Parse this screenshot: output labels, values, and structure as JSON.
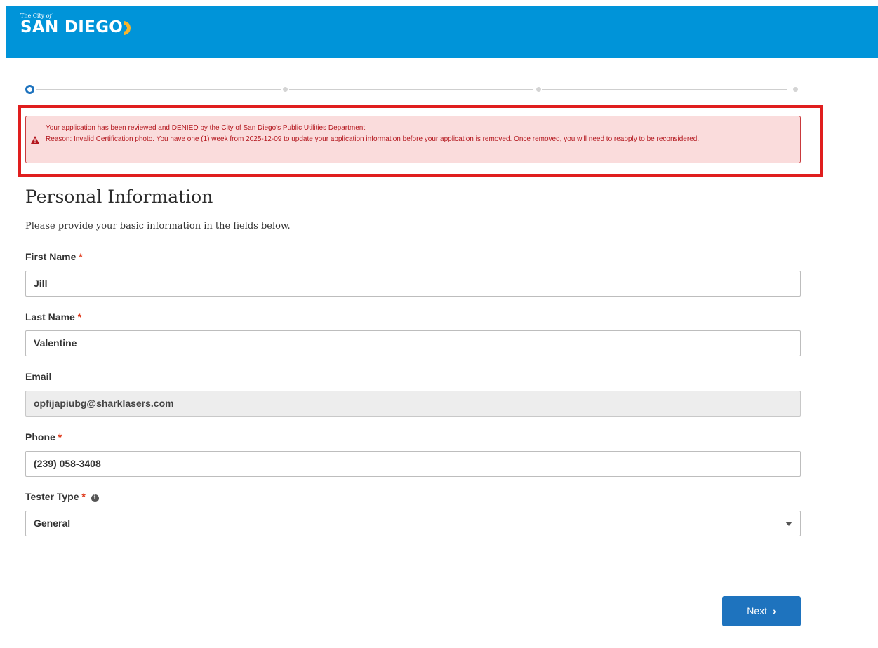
{
  "header": {
    "logo_small": "The City of",
    "logo_big": "SAN DIEGO",
    "brand_color": "#0094d9"
  },
  "stepper": {
    "total_steps": 4,
    "current_step": 1
  },
  "alert": {
    "line1": "Your application has been reviewed and DENIED by the City of San Diego's Public Utilities Department.",
    "line2": "Reason: Invalid Certification photo. You have one (1) week from 2025-12-09 to update your application information before your application is removed. Once removed, you will need to reapply to be reconsidered.",
    "icon": "warning-icon",
    "color": "#b3161d"
  },
  "form": {
    "title": "Personal Information",
    "subtitle": "Please provide your basic information in the fields below.",
    "required_marker": "*",
    "first_name": {
      "label": "First Name",
      "value": "Jill"
    },
    "last_name": {
      "label": "Last Name",
      "value": "Valentine"
    },
    "email": {
      "label": "Email",
      "value": "opfijapiubg@sharklasers.com"
    },
    "phone": {
      "label": "Phone",
      "value": "(239) 058-3408"
    },
    "tester_type": {
      "label": "Tester Type",
      "value": "General",
      "info_icon": "info-icon"
    }
  },
  "actions": {
    "next_label": "Next",
    "next_chevron": "›",
    "button_color": "#1e73be"
  }
}
